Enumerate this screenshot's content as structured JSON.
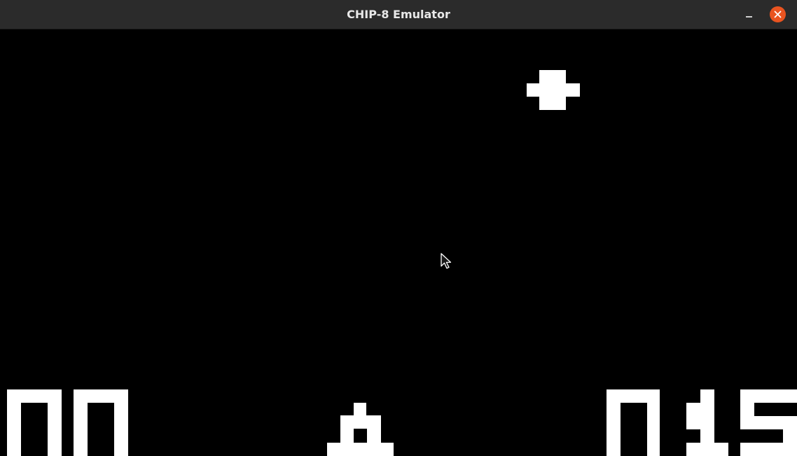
{
  "window": {
    "title": "CHIP-8 Emulator",
    "minimize_icon": "minimize-icon",
    "close_icon": "close-icon",
    "close_color": "#e95420"
  },
  "display": {
    "background": "#000000",
    "pixel_color": "#ffffff",
    "score_left": "00",
    "score_right": "015"
  }
}
